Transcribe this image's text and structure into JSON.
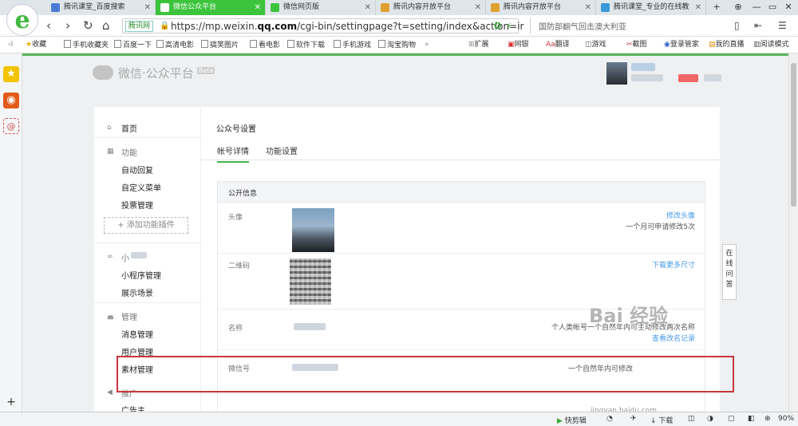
{
  "browser": {
    "tabs": [
      {
        "label": "腾讯课堂_百度搜索",
        "color": "#4a7bd6"
      },
      {
        "label": "微信公众平台",
        "color": "#3cc43c",
        "active": true
      },
      {
        "label": "微信网页版",
        "color": "#3cc43c"
      },
      {
        "label": "腾讯内容开放平台",
        "color": "#e0a030"
      },
      {
        "label": "腾讯内容开放平台",
        "color": "#e0a030"
      },
      {
        "label": "腾讯课堂_专业的在线教",
        "color": "#3a9ad9"
      }
    ],
    "new_tab": "+",
    "window_controls": [
      "⊕",
      "—",
      "▭",
      "✕"
    ],
    "nav_icons": [
      "‹",
      "›",
      "↻",
      "⌂"
    ],
    "site_badge": "腾讯网",
    "url_host": "mp.weixin.",
    "url_bold": "qq.com",
    "url_prefix": "https://",
    "url_rest": "/cgi-bin/settingpage?t=setting/index&action=ir",
    "search_text": "国防部翻气回击澳大利亚",
    "right_icons": [
      "▯",
      "⇤",
      "☰"
    ]
  },
  "bookmarks": [
    "收藏",
    "手机收藏夹",
    "百度一下",
    "高清电影",
    "搞笑图片",
    "看电影",
    "软件下载",
    "手机游戏",
    "淘宝购物",
    "»"
  ],
  "bookmarks_right": [
    "扩展",
    "网银",
    "翻译",
    "游戏",
    "截图",
    "登录管家",
    "我的直播",
    "阅读模式"
  ],
  "mp": {
    "logo_text": "微信·公众平台",
    "beta": "Beta"
  },
  "sidebar": {
    "home": "首页",
    "features": "功能",
    "auto_reply": "自动回复",
    "custom_menu": "自定义菜单",
    "vote": "投票管理",
    "add_plugin": "+ 添加功能插件",
    "mini": "小",
    "mini_manage": "小程序管理",
    "scenes": "展示场景",
    "manage": "管理",
    "msg": "消息管理",
    "users": "用户管理",
    "material": "素材管理",
    "promo": "推广",
    "ads": "广告主"
  },
  "content": {
    "title": "公众号设置",
    "tab_account": "帐号详情",
    "tab_func": "功能设置",
    "panel_title": "公开信息",
    "row_avatar_label": "头像",
    "change_avatar": "修改头像",
    "avatar_note": "一个月可申请修改5次",
    "row_qr_label": "二维码",
    "download_more": "下载更多尺寸",
    "row_name_label": "名称",
    "name_note": "个人类帐号一个自然年内可主动修改两次名称",
    "view_record": "查看改名记录",
    "row_wxid_label": "微信号",
    "wxid_note": "一个自然年内可修改",
    "online_qa": "在线问答"
  },
  "watermark": {
    "main": "Bai 经验",
    "sub": "jingyan.baidu.com"
  },
  "statusbar": {
    "kuaijian": "快剪辑",
    "download": "↓ 下载",
    "zoom": "90%"
  }
}
